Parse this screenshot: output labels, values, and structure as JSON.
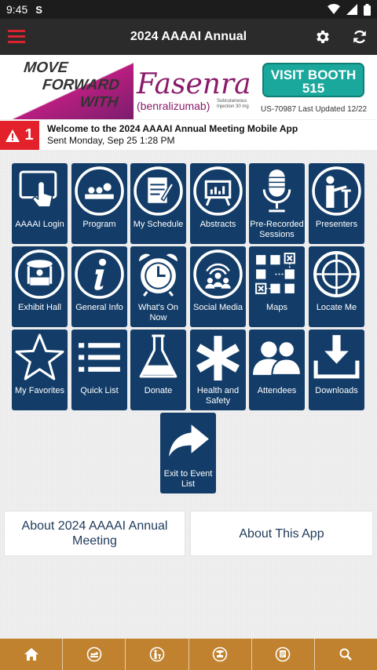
{
  "status": {
    "time": "9:45",
    "s_icon": "S"
  },
  "topbar": {
    "title": "2024 AAAAI Annual"
  },
  "banner": {
    "tagline": [
      "MOVE",
      "FORWARD",
      "WITH"
    ],
    "brand": "Fasenra",
    "generic": "(benralizumab)",
    "dose_note": "Subcutaneous Injection 30 mg",
    "booth_label": "VISIT BOOTH 515",
    "fine_print": "US-70987  Last Updated 12/22"
  },
  "alert": {
    "count": "1",
    "title": "Welcome to the 2024 AAAAI Annual Meeting Mobile App",
    "subtitle": "Sent Monday, Sep 25 1:28 PM"
  },
  "tiles": [
    {
      "label": "AAAAI Login",
      "icon": "touch-screen-icon"
    },
    {
      "label": "Program",
      "icon": "audience-icon"
    },
    {
      "label": "My Schedule",
      "icon": "calendar-note-icon"
    },
    {
      "label": "Abstracts",
      "icon": "presentation-board-icon"
    },
    {
      "label": "Pre-Recorded Sessions",
      "icon": "microphone-icon"
    },
    {
      "label": "Presenters",
      "icon": "presenter-icon"
    },
    {
      "label": "Exhibit Hall",
      "icon": "booth-icon"
    },
    {
      "label": "General Info",
      "icon": "info-icon"
    },
    {
      "label": "What's On Now",
      "icon": "alarm-clock-icon"
    },
    {
      "label": "Social Media",
      "icon": "social-people-icon"
    },
    {
      "label": "Maps",
      "icon": "map-grid-icon"
    },
    {
      "label": "Locate Me",
      "icon": "crosshair-icon"
    },
    {
      "label": "My Favorites",
      "icon": "star-icon"
    },
    {
      "label": "Quick List",
      "icon": "list-icon"
    },
    {
      "label": "Donate",
      "icon": "flask-icon"
    },
    {
      "label": "Health and Safety",
      "icon": "medical-cross-icon"
    },
    {
      "label": "Attendees",
      "icon": "people-icon"
    },
    {
      "label": "Downloads",
      "icon": "download-icon"
    },
    {
      "label": "Exit to Event List",
      "icon": "share-arrow-icon"
    }
  ],
  "about": {
    "meeting": "About 2024 AAAAI Annual Meeting",
    "app": "About This App"
  },
  "bottom_nav": [
    "home-icon",
    "audience-icon",
    "presenter-icon",
    "booth-icon",
    "calendar-icon",
    "search-icon"
  ],
  "colors": {
    "tile": "#133d68",
    "accent_red": "#d9232e",
    "bottom_bar": "#c0822f",
    "booth": "#1aa89c"
  }
}
